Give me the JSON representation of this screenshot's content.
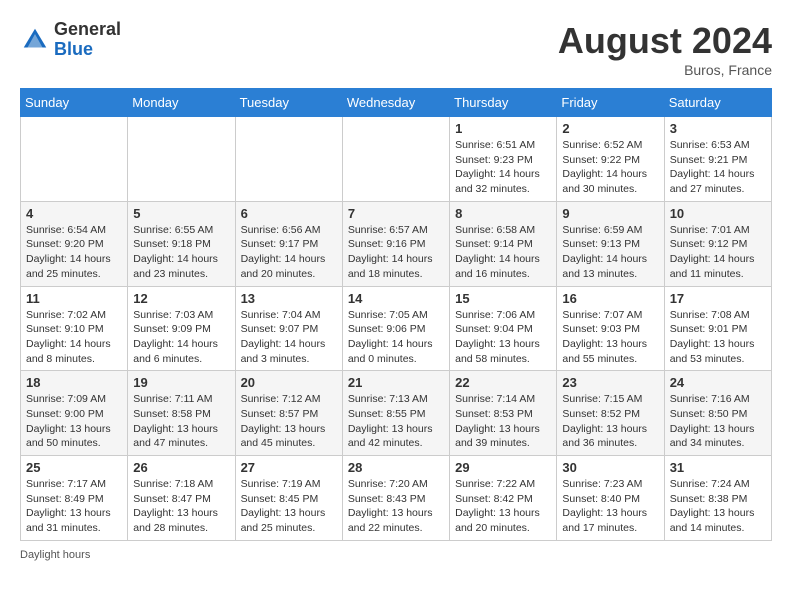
{
  "header": {
    "logo_line1": "General",
    "logo_line2": "Blue",
    "month_year": "August 2024",
    "location": "Buros, France"
  },
  "weekdays": [
    "Sunday",
    "Monday",
    "Tuesday",
    "Wednesday",
    "Thursday",
    "Friday",
    "Saturday"
  ],
  "weeks": [
    [
      {
        "day": "",
        "info": ""
      },
      {
        "day": "",
        "info": ""
      },
      {
        "day": "",
        "info": ""
      },
      {
        "day": "",
        "info": ""
      },
      {
        "day": "1",
        "info": "Sunrise: 6:51 AM\nSunset: 9:23 PM\nDaylight: 14 hours\nand 32 minutes."
      },
      {
        "day": "2",
        "info": "Sunrise: 6:52 AM\nSunset: 9:22 PM\nDaylight: 14 hours\nand 30 minutes."
      },
      {
        "day": "3",
        "info": "Sunrise: 6:53 AM\nSunset: 9:21 PM\nDaylight: 14 hours\nand 27 minutes."
      }
    ],
    [
      {
        "day": "4",
        "info": "Sunrise: 6:54 AM\nSunset: 9:20 PM\nDaylight: 14 hours\nand 25 minutes."
      },
      {
        "day": "5",
        "info": "Sunrise: 6:55 AM\nSunset: 9:18 PM\nDaylight: 14 hours\nand 23 minutes."
      },
      {
        "day": "6",
        "info": "Sunrise: 6:56 AM\nSunset: 9:17 PM\nDaylight: 14 hours\nand 20 minutes."
      },
      {
        "day": "7",
        "info": "Sunrise: 6:57 AM\nSunset: 9:16 PM\nDaylight: 14 hours\nand 18 minutes."
      },
      {
        "day": "8",
        "info": "Sunrise: 6:58 AM\nSunset: 9:14 PM\nDaylight: 14 hours\nand 16 minutes."
      },
      {
        "day": "9",
        "info": "Sunrise: 6:59 AM\nSunset: 9:13 PM\nDaylight: 14 hours\nand 13 minutes."
      },
      {
        "day": "10",
        "info": "Sunrise: 7:01 AM\nSunset: 9:12 PM\nDaylight: 14 hours\nand 11 minutes."
      }
    ],
    [
      {
        "day": "11",
        "info": "Sunrise: 7:02 AM\nSunset: 9:10 PM\nDaylight: 14 hours\nand 8 minutes."
      },
      {
        "day": "12",
        "info": "Sunrise: 7:03 AM\nSunset: 9:09 PM\nDaylight: 14 hours\nand 6 minutes."
      },
      {
        "day": "13",
        "info": "Sunrise: 7:04 AM\nSunset: 9:07 PM\nDaylight: 14 hours\nand 3 minutes."
      },
      {
        "day": "14",
        "info": "Sunrise: 7:05 AM\nSunset: 9:06 PM\nDaylight: 14 hours\nand 0 minutes."
      },
      {
        "day": "15",
        "info": "Sunrise: 7:06 AM\nSunset: 9:04 PM\nDaylight: 13 hours\nand 58 minutes."
      },
      {
        "day": "16",
        "info": "Sunrise: 7:07 AM\nSunset: 9:03 PM\nDaylight: 13 hours\nand 55 minutes."
      },
      {
        "day": "17",
        "info": "Sunrise: 7:08 AM\nSunset: 9:01 PM\nDaylight: 13 hours\nand 53 minutes."
      }
    ],
    [
      {
        "day": "18",
        "info": "Sunrise: 7:09 AM\nSunset: 9:00 PM\nDaylight: 13 hours\nand 50 minutes."
      },
      {
        "day": "19",
        "info": "Sunrise: 7:11 AM\nSunset: 8:58 PM\nDaylight: 13 hours\nand 47 minutes."
      },
      {
        "day": "20",
        "info": "Sunrise: 7:12 AM\nSunset: 8:57 PM\nDaylight: 13 hours\nand 45 minutes."
      },
      {
        "day": "21",
        "info": "Sunrise: 7:13 AM\nSunset: 8:55 PM\nDaylight: 13 hours\nand 42 minutes."
      },
      {
        "day": "22",
        "info": "Sunrise: 7:14 AM\nSunset: 8:53 PM\nDaylight: 13 hours\nand 39 minutes."
      },
      {
        "day": "23",
        "info": "Sunrise: 7:15 AM\nSunset: 8:52 PM\nDaylight: 13 hours\nand 36 minutes."
      },
      {
        "day": "24",
        "info": "Sunrise: 7:16 AM\nSunset: 8:50 PM\nDaylight: 13 hours\nand 34 minutes."
      }
    ],
    [
      {
        "day": "25",
        "info": "Sunrise: 7:17 AM\nSunset: 8:49 PM\nDaylight: 13 hours\nand 31 minutes."
      },
      {
        "day": "26",
        "info": "Sunrise: 7:18 AM\nSunset: 8:47 PM\nDaylight: 13 hours\nand 28 minutes."
      },
      {
        "day": "27",
        "info": "Sunrise: 7:19 AM\nSunset: 8:45 PM\nDaylight: 13 hours\nand 25 minutes."
      },
      {
        "day": "28",
        "info": "Sunrise: 7:20 AM\nSunset: 8:43 PM\nDaylight: 13 hours\nand 22 minutes."
      },
      {
        "day": "29",
        "info": "Sunrise: 7:22 AM\nSunset: 8:42 PM\nDaylight: 13 hours\nand 20 minutes."
      },
      {
        "day": "30",
        "info": "Sunrise: 7:23 AM\nSunset: 8:40 PM\nDaylight: 13 hours\nand 17 minutes."
      },
      {
        "day": "31",
        "info": "Sunrise: 7:24 AM\nSunset: 8:38 PM\nDaylight: 13 hours\nand 14 minutes."
      }
    ]
  ],
  "footer": {
    "note": "Daylight hours"
  }
}
